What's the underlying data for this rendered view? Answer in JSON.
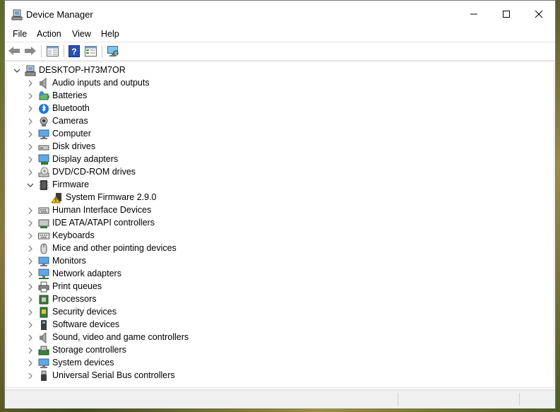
{
  "window": {
    "title": "Device Manager",
    "controls": {
      "minimize": "minimize",
      "maximize": "maximize",
      "close": "close"
    }
  },
  "menu": [
    "File",
    "Action",
    "View",
    "Help"
  ],
  "toolbar": {
    "buttons": [
      "back-arrow-icon",
      "forward-arrow-icon",
      "show-hide-console-tree-icon",
      "help-icon",
      "properties-icon",
      "scan-hardware-icon"
    ]
  },
  "tree": {
    "root": "DESKTOP-H73M7OR",
    "items": [
      {
        "label": "Audio inputs and outputs",
        "icon": "speaker-icon",
        "expanded": false
      },
      {
        "label": "Batteries",
        "icon": "battery-icon",
        "expanded": false
      },
      {
        "label": "Bluetooth",
        "icon": "bluetooth-icon",
        "expanded": false
      },
      {
        "label": "Cameras",
        "icon": "camera-icon",
        "expanded": false
      },
      {
        "label": "Computer",
        "icon": "computer-icon",
        "expanded": false
      },
      {
        "label": "Disk drives",
        "icon": "disk-drive-icon",
        "expanded": false
      },
      {
        "label": "Display adapters",
        "icon": "display-adapter-icon",
        "expanded": false
      },
      {
        "label": "DVD/CD-ROM drives",
        "icon": "dvd-drive-icon",
        "expanded": false
      },
      {
        "label": "Firmware",
        "icon": "firmware-icon",
        "expanded": true,
        "children": [
          {
            "label": "System Firmware 2.9.0",
            "icon": "warning-firmware-icon"
          }
        ]
      },
      {
        "label": "Human Interface Devices",
        "icon": "hid-icon",
        "expanded": false
      },
      {
        "label": "IDE ATA/ATAPI controllers",
        "icon": "ide-controller-icon",
        "expanded": false
      },
      {
        "label": "Keyboards",
        "icon": "keyboard-icon",
        "expanded": false
      },
      {
        "label": "Mice and other pointing devices",
        "icon": "mouse-icon",
        "expanded": false
      },
      {
        "label": "Monitors",
        "icon": "monitor-icon",
        "expanded": false
      },
      {
        "label": "Network adapters",
        "icon": "network-adapter-icon",
        "expanded": false
      },
      {
        "label": "Print queues",
        "icon": "printer-icon",
        "expanded": false
      },
      {
        "label": "Processors",
        "icon": "processor-icon",
        "expanded": false
      },
      {
        "label": "Security devices",
        "icon": "security-device-icon",
        "expanded": false
      },
      {
        "label": "Software devices",
        "icon": "software-device-icon",
        "expanded": false
      },
      {
        "label": "Sound, video and game controllers",
        "icon": "sound-controller-icon",
        "expanded": false
      },
      {
        "label": "Storage controllers",
        "icon": "storage-controller-icon",
        "expanded": false
      },
      {
        "label": "System devices",
        "icon": "system-device-icon",
        "expanded": false
      },
      {
        "label": "Universal Serial Bus controllers",
        "icon": "usb-icon",
        "expanded": false
      }
    ]
  },
  "status": {
    "pane1": "",
    "pane2": "",
    "pane3": ""
  },
  "colors": {
    "selection": "#cce8ff",
    "accent": "#1e90ff",
    "warning": "#f2c200"
  }
}
